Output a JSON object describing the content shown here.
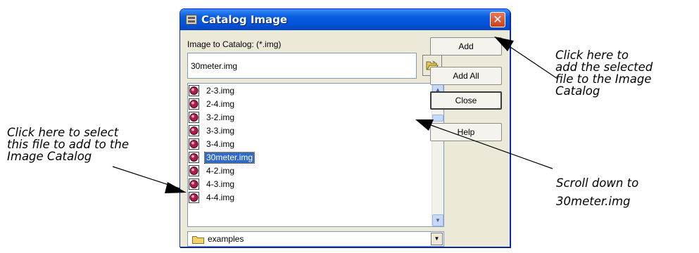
{
  "dialog": {
    "title": "Catalog Image",
    "close_glyph": "✕",
    "field_label": "Image to Catalog: (*.img)",
    "filename_value": "30meter.img",
    "folder_button_icon": "open-folder-icon",
    "file_list": [
      {
        "name": "2-3.img",
        "selected": false
      },
      {
        "name": "2-4.img",
        "selected": false
      },
      {
        "name": "3-2.img",
        "selected": false
      },
      {
        "name": "3-3.img",
        "selected": false
      },
      {
        "name": "3-4.img",
        "selected": false
      },
      {
        "name": "30meter.img",
        "selected": true
      },
      {
        "name": "4-2.img",
        "selected": false
      },
      {
        "name": "4-3.img",
        "selected": false
      },
      {
        "name": "4-4.img",
        "selected": false
      }
    ],
    "folder_select_value": "examples",
    "buttons": {
      "add": "Add",
      "add_all": "Add All",
      "close": "Close",
      "help": "Help"
    },
    "colors": {
      "title_bar": "#0553d8",
      "selection": "#316ac5"
    }
  },
  "annotations": {
    "add": [
      "Click here to",
      "add the selected",
      "file to the Image",
      "Catalog"
    ],
    "scroll": [
      "Scroll down to",
      "30meter.img"
    ],
    "select": [
      "Click here to select",
      "this file to add to the",
      "Image Catalog"
    ]
  }
}
